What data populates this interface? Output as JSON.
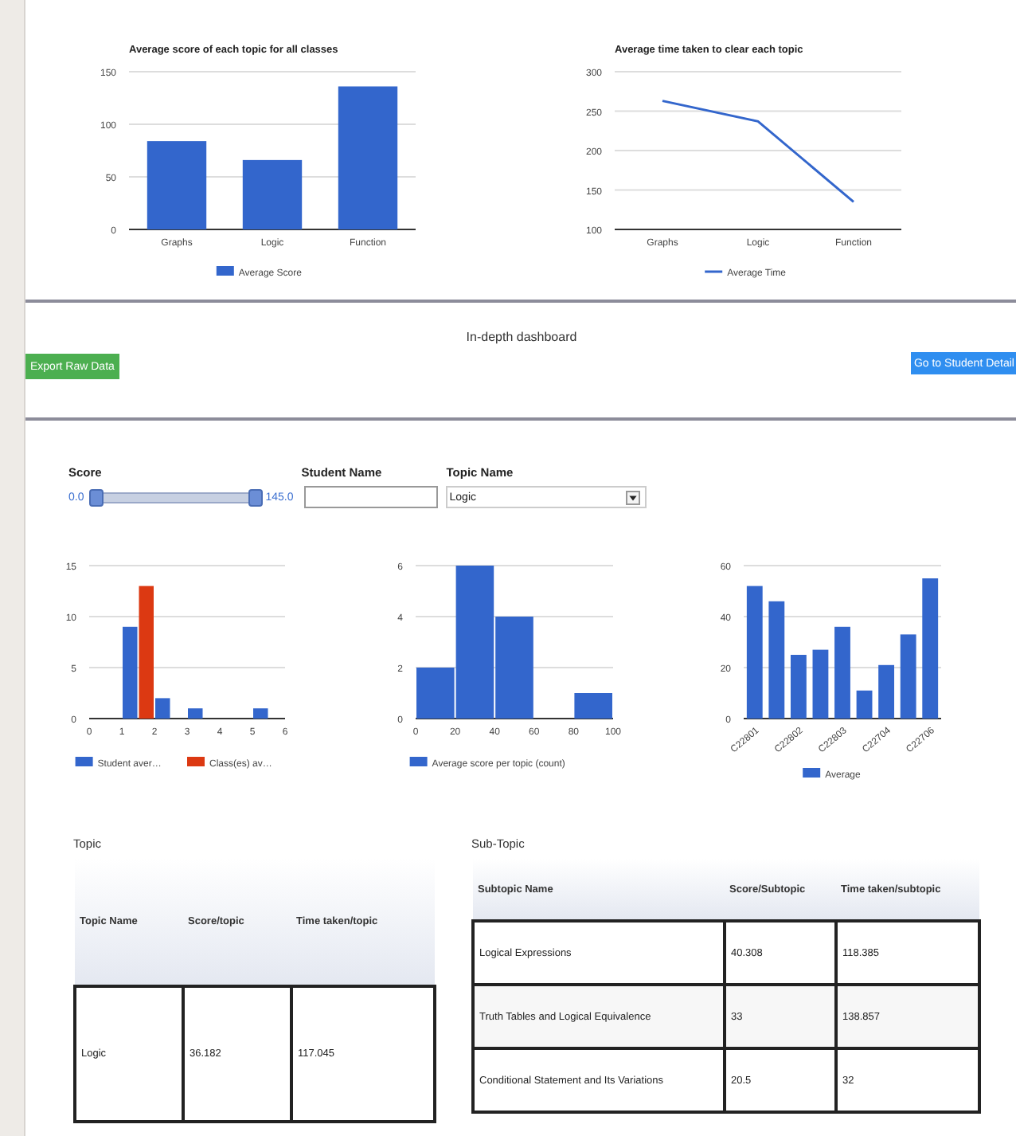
{
  "top_charts": [
    {
      "chart_data": {
        "type": "bar",
        "title": "Average score of each topic for all classes",
        "categories": [
          "Graphs",
          "Logic",
          "Function"
        ],
        "series": [
          {
            "name": "Average Score",
            "color": "#3366cc",
            "values": [
              84,
              66,
              136
            ]
          }
        ],
        "ylim": [
          0,
          150
        ],
        "yticks": [
          0,
          50,
          100,
          150
        ],
        "grid": true,
        "legend": "bottom"
      }
    },
    {
      "chart_data": {
        "type": "line",
        "title": "Average time taken to clear each topic",
        "categories": [
          "Graphs",
          "Logic",
          "Function"
        ],
        "series": [
          {
            "name": "Average Time",
            "color": "#3366cc",
            "values": [
              263,
              237,
              135
            ]
          }
        ],
        "ylim": [
          100,
          300
        ],
        "yticks": [
          100,
          150,
          200,
          250,
          300
        ],
        "grid": true,
        "legend": "bottom"
      }
    }
  ],
  "header": {
    "title": "In-depth dashboard",
    "buttons": [
      {
        "label": "Export Raw Data",
        "kind": "export"
      },
      {
        "label": "Go to Student Detail",
        "kind": "details"
      }
    ]
  },
  "filters": {
    "score": {
      "label": "Score",
      "min": "0.0",
      "max": "145.0",
      "thumbs": [
        {
          "level": 0
        },
        {
          "level": 1
        }
      ]
    },
    "student_name": {
      "label": "Student Name"
    },
    "topic_name": {
      "label": "Topic Name",
      "value": "Logic"
    }
  },
  "charts": [
    {
      "chart_data": {
        "type": "bar",
        "x": [
          1.25,
          1.75,
          2.25,
          3.25,
          5.25
        ],
        "series": [
          {
            "name": "Student aver…",
            "color": "#3366cc",
            "values": [
              9,
              null,
              2,
              1,
              1
            ]
          },
          {
            "name": "Class(es) av…",
            "color": "#dc3912",
            "values": [
              null,
              13,
              null,
              null,
              null
            ]
          }
        ],
        "xlim": [
          0,
          6
        ],
        "xticks": [
          0,
          1,
          2,
          3,
          4,
          5,
          6
        ],
        "ylim": [
          0,
          15
        ],
        "yticks": [
          0,
          5,
          10,
          15
        ],
        "grid": true,
        "legend": "bottom"
      }
    },
    {
      "chart_data": {
        "type": "bar",
        "x": [
          10,
          30,
          50,
          70,
          90
        ],
        "series": [
          {
            "name": "Average score per topic (count)",
            "color": "#3366cc",
            "values": [
              2,
              6,
              4,
              0,
              1
            ]
          }
        ],
        "xlim": [
          0,
          100
        ],
        "xticks": [
          0,
          20,
          40,
          60,
          80,
          100
        ],
        "ylim": [
          0,
          6
        ],
        "yticks": [
          0,
          2,
          4,
          6
        ],
        "grid": true,
        "legend": "bottom"
      }
    },
    {
      "chart_data": {
        "type": "bar",
        "categories": [
          "C22801",
          null,
          "C22802",
          null,
          "C22803",
          null,
          "C22704",
          null,
          "C22706"
        ],
        "series": [
          {
            "name": "Average",
            "color": "#3366cc",
            "values": [
              52,
              46,
              25,
              27,
              36,
              11,
              21,
              33,
              55
            ]
          }
        ],
        "ylim": [
          0,
          60
        ],
        "yticks": [
          0,
          20,
          40,
          60
        ],
        "grid": true,
        "legend": "bottom"
      }
    }
  ],
  "topic_table": {
    "title": "Topic",
    "columns": [
      "Topic Name",
      "Score/topic",
      "Time taken/topic"
    ],
    "rows": [
      [
        "Logic",
        "36.182",
        "117.045"
      ]
    ]
  },
  "subtopic_table": {
    "title": "Sub-Topic",
    "columns": [
      "Subtopic Name",
      "Score/Subtopic",
      "Time taken/subtopic"
    ],
    "rows": [
      [
        "Logical Expressions",
        "40.308",
        "118.385"
      ],
      [
        "Truth Tables and Logical Equivalence",
        "33",
        "138.857"
      ],
      [
        "Conditional Statement and Its Variations",
        "20.5",
        "32"
      ]
    ]
  }
}
